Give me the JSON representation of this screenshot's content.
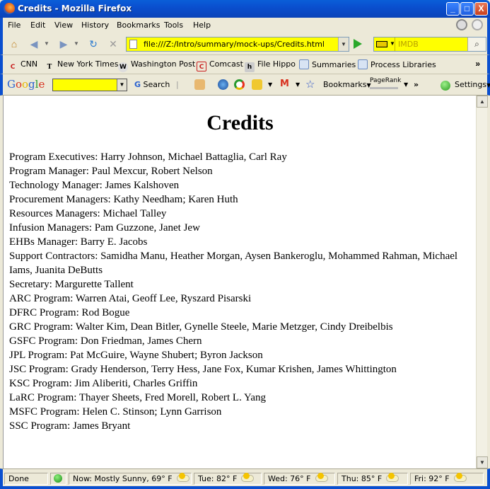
{
  "window": {
    "title": "Credits - Mozilla Firefox",
    "min_label": "_",
    "max_label": "□",
    "close_label": "X"
  },
  "menu": [
    "File",
    "Edit",
    "View",
    "History",
    "Bookmarks",
    "Tools",
    "Help"
  ],
  "nav": {
    "url": "file:///Z:/Intro/summary/mock-ups/Credits.html",
    "search_placeholder": "IMDB",
    "icons": [
      "home-icon",
      "back-icon",
      "forward-icon",
      "reload-icon",
      "stop-icon",
      "go-icon",
      "magnifier-icon"
    ]
  },
  "bookmarks": [
    "CNN",
    "New York Times",
    "Washington Post",
    "Comcast",
    "File Hippo",
    "Summaries",
    "Process Libraries"
  ],
  "google_toolbar": {
    "logo": "Google",
    "search_label": "Search",
    "bookmarks_label": "Bookmarks",
    "pagerank_label": "PageRank",
    "settings_label": "Settings",
    "colors": {
      "search_field": "#ffff00",
      "url_field": "#ffff00"
    }
  },
  "page": {
    "heading": "Credits",
    "lines": [
      "Program Executives: Harry Johnson, Michael Battaglia, Carl Ray",
      "Program Manager: Paul Mexcur, Robert Nelson",
      "Technology Manager: James Kalshoven",
      "Procurement Managers: Kathy Needham; Karen Huth",
      "Resources Managers: Michael Talley",
      "Infusion Managers: Pam Guzzone, Janet Jew",
      "EHBs Manager: Barry E. Jacobs",
      "Support Contractors: Samidha Manu, Heather Morgan, Aysen Bankeroglu, Mohammed Rahman, Michael Iams, Juanita DeButts",
      "Secretary: Margurette Tallent",
      "ARC Program: Warren Atai, Geoff Lee, Ryszard Pisarski",
      "DFRC Program: Rod Bogue",
      "GRC Program: Walter Kim, Dean Bitler, Gynelle Steele, Marie Metzger, Cindy Dreibelbis",
      "GSFC Program: Don Friedman, James Chern",
      "JPL Program: Pat McGuire, Wayne Shubert; Byron Jackson",
      "JSC Program: Grady Henderson, Terry Hess, Jane Fox, Kumar Krishen, James Whittington",
      "KSC Program: Jim Aliberiti, Charles Griffin",
      "LaRC Program: Thayer Sheets, Fred Morell, Robert L. Yang",
      "MSFC Program: Helen C. Stinson; Lynn Garrison",
      "SSC Program: James Bryant"
    ]
  },
  "status": {
    "text": "Done",
    "weather": [
      "Now: Mostly Sunny, 69° F",
      "Tue: 82° F",
      "Wed: 76° F",
      "Thu: 85° F",
      "Fri: 92° F"
    ]
  }
}
